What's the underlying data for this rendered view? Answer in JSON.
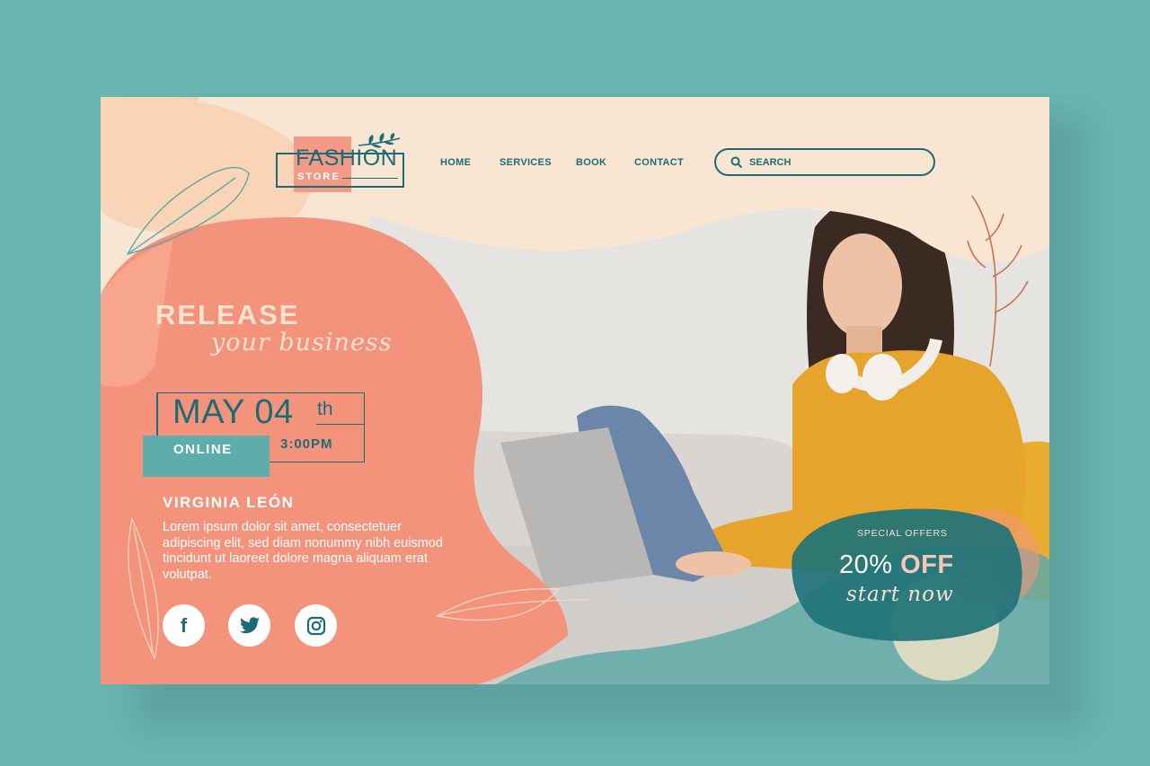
{
  "logo": {
    "word1": "FASHION",
    "word2": "STORE"
  },
  "nav": {
    "items": [
      "HOME",
      "SERVICES",
      "BOOK",
      "CONTACT"
    ]
  },
  "search": {
    "placeholder": "SEARCH"
  },
  "hero": {
    "headline": "RELEASE",
    "script": "your business",
    "date_main": "MAY 04",
    "date_suffix": "th",
    "mode": "ONLINE",
    "time": "3:00PM",
    "name": "VIRGINIA LEÓN",
    "body": "Lorem ipsum dolor sit amet, consectetuer adipiscing elit, sed diam nonummy nibh euismod tincidunt ut laoreet dolore magna aliquam erat volutpat."
  },
  "offer": {
    "label": "SPECIAL OFFERS",
    "percent": "20%",
    "off": "OFF",
    "cta": "start now"
  },
  "social": [
    "facebook-icon",
    "twitter-icon",
    "instagram-icon"
  ],
  "colors": {
    "background": "#68b5b1",
    "teal": "#1c6c76",
    "coral": "#f4937c",
    "cream": "#f8e6d3",
    "mustard": "#e8a634"
  }
}
